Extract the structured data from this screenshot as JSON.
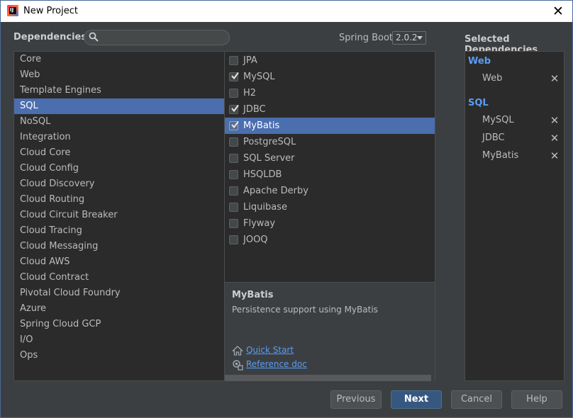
{
  "window": {
    "title": "New Project",
    "icon_text": "IJ"
  },
  "header": {
    "dependencies_label": "Dependencies",
    "search_placeholder": "",
    "spring_boot_label": "Spring Boot",
    "spring_boot_version": "2.0.2",
    "selected_title": "Selected Dependencies"
  },
  "categories": [
    "Core",
    "Web",
    "Template Engines",
    "SQL",
    "NoSQL",
    "Integration",
    "Cloud Core",
    "Cloud Config",
    "Cloud Discovery",
    "Cloud Routing",
    "Cloud Circuit Breaker",
    "Cloud Tracing",
    "Cloud Messaging",
    "Cloud AWS",
    "Cloud Contract",
    "Pivotal Cloud Foundry",
    "Azure",
    "Spring Cloud GCP",
    "I/O",
    "Ops"
  ],
  "selected_category": "SQL",
  "dependencies": [
    {
      "label": "JPA",
      "checked": false
    },
    {
      "label": "MySQL",
      "checked": true
    },
    {
      "label": "H2",
      "checked": false
    },
    {
      "label": "JDBC",
      "checked": true
    },
    {
      "label": "MyBatis",
      "checked": true
    },
    {
      "label": "PostgreSQL",
      "checked": false
    },
    {
      "label": "SQL Server",
      "checked": false
    },
    {
      "label": "HSQLDB",
      "checked": false
    },
    {
      "label": "Apache Derby",
      "checked": false
    },
    {
      "label": "Liquibase",
      "checked": false
    },
    {
      "label": "Flyway",
      "checked": false
    },
    {
      "label": "JOOQ",
      "checked": false
    }
  ],
  "selected_dependency": "MyBatis",
  "description": {
    "title": "MyBatis",
    "text": "Persistence support using MyBatis",
    "quick_start": "Quick Start",
    "reference_doc": "Reference doc"
  },
  "selected_groups": [
    {
      "name": "Web",
      "items": [
        "Web"
      ]
    },
    {
      "name": "SQL",
      "items": [
        "MySQL",
        "JDBC",
        "MyBatis"
      ]
    }
  ],
  "remove_glyph": "✕",
  "buttons": {
    "previous": "Previous",
    "next": "Next",
    "cancel": "Cancel",
    "help": "Help"
  }
}
